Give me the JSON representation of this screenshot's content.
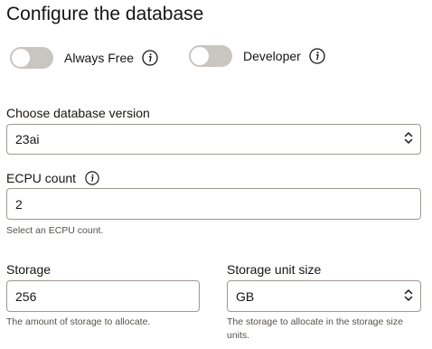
{
  "page": {
    "title": "Configure the database"
  },
  "toggles": {
    "always_free": {
      "label": "Always Free",
      "on": false
    },
    "developer": {
      "label": "Developer",
      "on": false
    }
  },
  "version": {
    "label": "Choose database version",
    "value": "23ai"
  },
  "ecpu": {
    "label": "ECPU count",
    "value": "2",
    "helper": "Select an ECPU count."
  },
  "storage": {
    "label": "Storage",
    "value": "256",
    "helper": "The amount of storage to allocate."
  },
  "storage_unit": {
    "label": "Storage unit size",
    "value": "GB",
    "helper": "The storage to allocate in the storage size units."
  },
  "icons": {
    "info": "info-icon",
    "select": "chevron-up-down-icon"
  },
  "colors": {
    "switch_off": "#c9c5c1",
    "text": "#161513",
    "border": "#9e9892"
  }
}
